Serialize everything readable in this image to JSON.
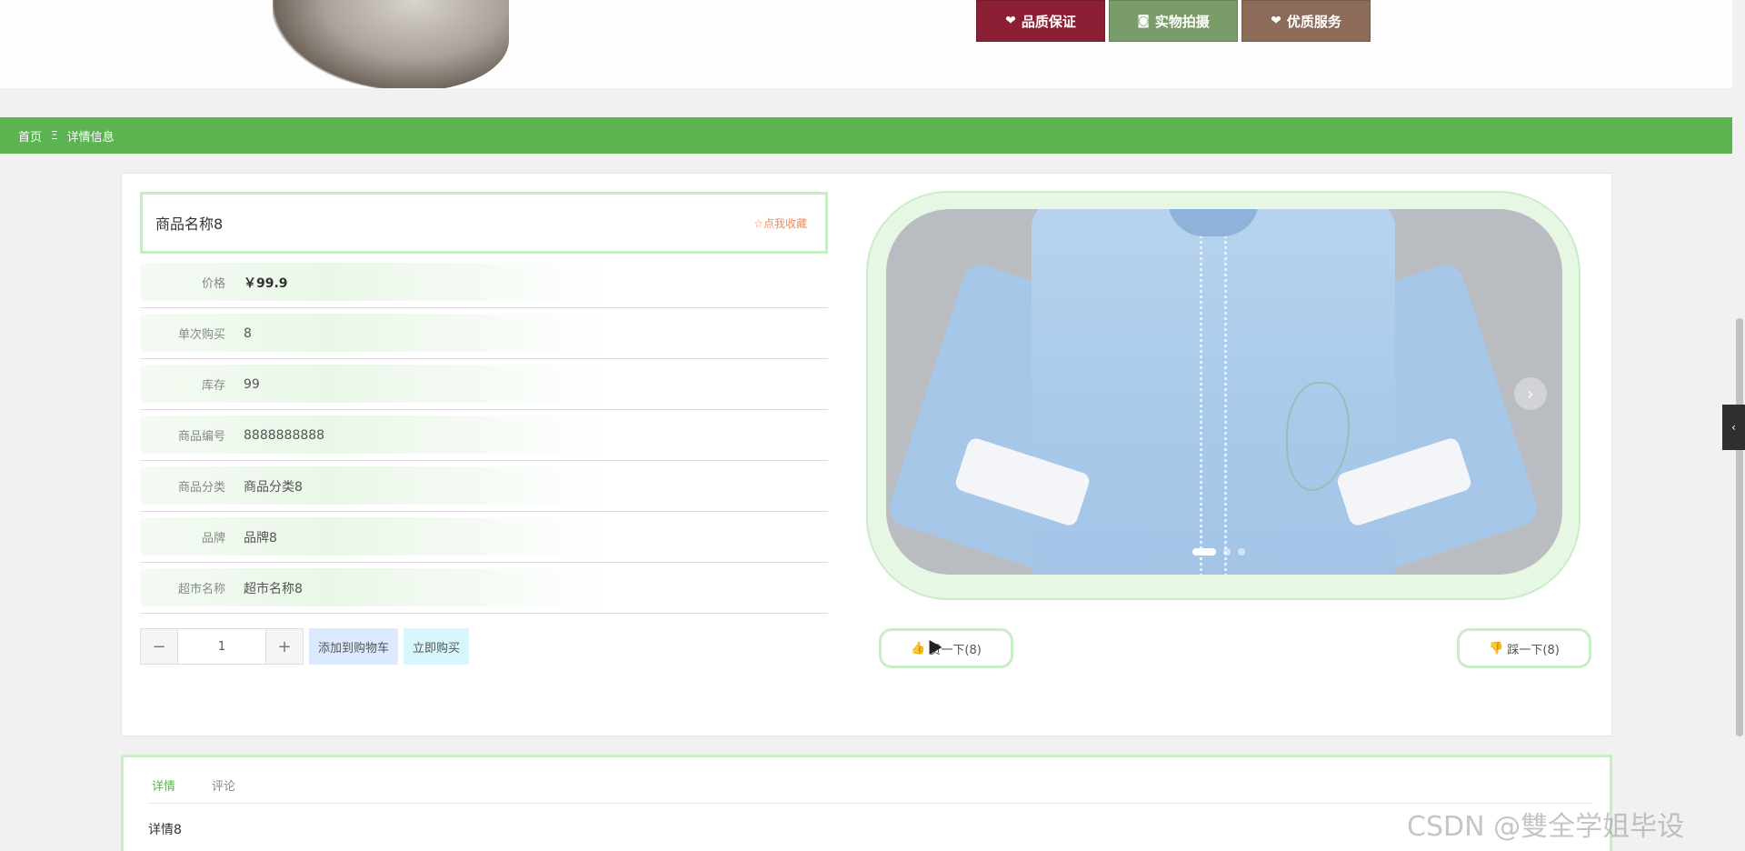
{
  "banner": {
    "badges": [
      {
        "icon": "heart-icon",
        "label": "品质保证",
        "color": "#8b2035"
      },
      {
        "icon": "camera-icon",
        "label": "实物拍摄",
        "color": "#7a9c68"
      },
      {
        "icon": "heart-icon",
        "label": "优质服务",
        "color": "#8c6c58"
      }
    ]
  },
  "breadcrumb": {
    "home": "首页",
    "separator": "Ξ",
    "current": "详情信息"
  },
  "product": {
    "name": "商品名称8",
    "favorite_label": "☆点我收藏",
    "fields": [
      {
        "label": "价格",
        "value": "￥99.9"
      },
      {
        "label": "单次购买",
        "value": "8"
      },
      {
        "label": "库存",
        "value": "99"
      },
      {
        "label": "商品编号",
        "value": "8888888888"
      },
      {
        "label": "商品分类",
        "value": "商品分类8"
      },
      {
        "label": "品牌",
        "value": "品牌8"
      },
      {
        "label": "超市名称",
        "value": "超市名称8"
      }
    ]
  },
  "purchase": {
    "minus": "−",
    "plus": "+",
    "quantity": "1",
    "add_to_cart": "添加到购物车",
    "buy_now": "立即购买"
  },
  "carousel": {
    "next_icon": "chevron-right-icon",
    "slide_count": 3,
    "active_index": 0
  },
  "votes": {
    "up_icon": "thumbs-up-icon",
    "up_label": "赞一下(8)",
    "down_icon": "thumbs-down-icon",
    "down_label": "踩一下(8)"
  },
  "tabs": {
    "items": [
      "详情",
      "评论"
    ],
    "active": 0,
    "content": "详情8"
  },
  "side": {
    "toggle_icon": "chevron-left-icon"
  },
  "watermark": "CSDN @雙全学姐毕设",
  "colors": {
    "accent_green": "#5cb450",
    "light_green_border": "#c9edc6",
    "favorite_orange": "#f08c5a"
  }
}
